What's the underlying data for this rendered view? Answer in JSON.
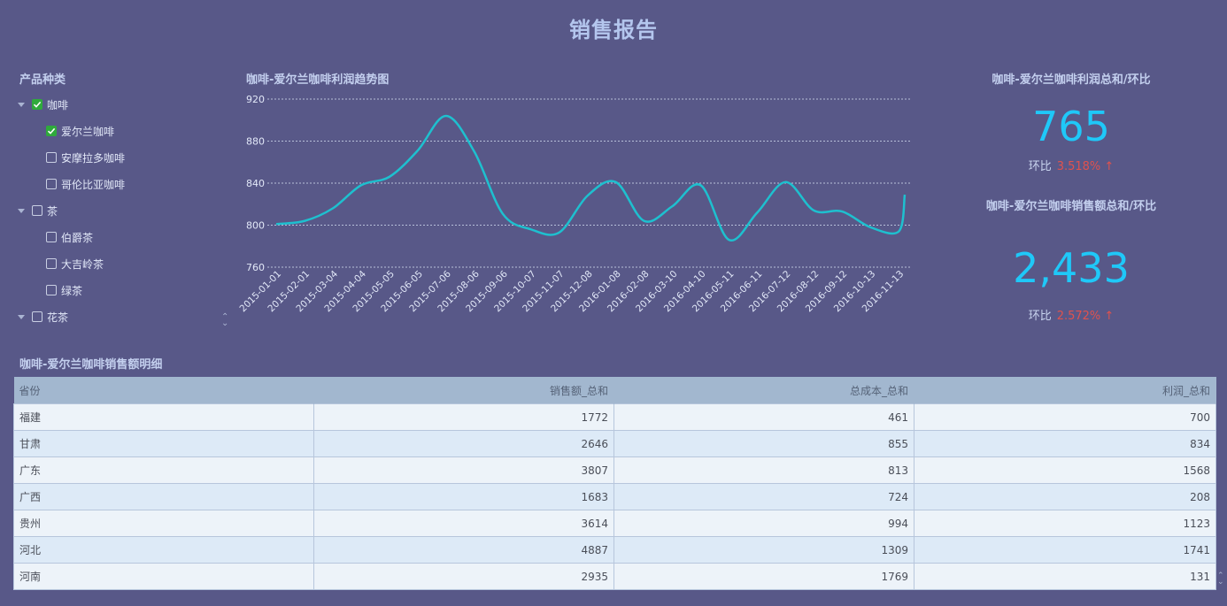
{
  "title": "销售报告",
  "filter": {
    "title": "产品种类",
    "items": [
      {
        "label": "咖啡",
        "level": 0,
        "checked": true,
        "expandable": true
      },
      {
        "label": "爱尔兰咖啡",
        "level": 1,
        "checked": true,
        "expandable": false
      },
      {
        "label": "安摩拉多咖啡",
        "level": 1,
        "checked": false,
        "expandable": false
      },
      {
        "label": "哥伦比亚咖啡",
        "level": 1,
        "checked": false,
        "expandable": false
      },
      {
        "label": "茶",
        "level": 0,
        "checked": false,
        "expandable": true
      },
      {
        "label": "伯爵茶",
        "level": 1,
        "checked": false,
        "expandable": false
      },
      {
        "label": "大吉岭茶",
        "level": 1,
        "checked": false,
        "expandable": false
      },
      {
        "label": "绿茶",
        "level": 1,
        "checked": false,
        "expandable": false
      },
      {
        "label": "花茶",
        "level": 0,
        "checked": false,
        "expandable": true
      }
    ]
  },
  "chart_data": {
    "type": "line",
    "title": "咖啡-爱尔兰咖啡利润趋势图",
    "xlabel": "",
    "ylabel": "",
    "x": [
      "2015-01-01",
      "2015-02-01",
      "2015-03-04",
      "2015-04-04",
      "2015-05-05",
      "2015-06-05",
      "2015-07-06",
      "2015-08-06",
      "2015-09-06",
      "2015-10-07",
      "2015-11-07",
      "2015-12-08",
      "2016-01-08",
      "2016-02-08",
      "2016-03-10",
      "2016-04-10",
      "2016-05-11",
      "2016-06-11",
      "2016-07-12",
      "2016-08-12",
      "2016-09-12",
      "2016-10-13",
      "2016-11-13"
    ],
    "series": [
      {
        "values": [
          801,
          804,
          816,
          838,
          846,
          871,
          904,
          870,
          811,
          796,
          793,
          828,
          841,
          804,
          818,
          838,
          786,
          812,
          841,
          814,
          813,
          798,
          794
        ]
      }
    ],
    "end_value": 829,
    "yticks": [
      760,
      800,
      840,
      880,
      920
    ],
    "ylim": [
      760,
      920
    ],
    "grid": true,
    "color": "#1ec0cf"
  },
  "kpis": [
    {
      "title": "咖啡-爱尔兰咖啡利润总和/环比",
      "value": "765",
      "sub_label": "环比",
      "delta": "3.518% ↑"
    },
    {
      "title": "咖啡-爱尔兰咖啡销售额总和/环比",
      "value": "2,433",
      "sub_label": "环比",
      "delta": "2.572% ↑"
    }
  ],
  "table": {
    "title": "咖啡-爱尔兰咖啡销售额明细",
    "columns": [
      "省份",
      "销售额_总和",
      "总成本_总和",
      "利润_总和"
    ],
    "rows": [
      [
        "福建",
        "1772",
        "461",
        "700"
      ],
      [
        "甘肃",
        "2646",
        "855",
        "834"
      ],
      [
        "广东",
        "3807",
        "813",
        "1568"
      ],
      [
        "广西",
        "1683",
        "724",
        "208"
      ],
      [
        "贵州",
        "3614",
        "994",
        "1123"
      ],
      [
        "河北",
        "4887",
        "1309",
        "1741"
      ],
      [
        "河南",
        "2935",
        "1769",
        "131"
      ]
    ]
  }
}
